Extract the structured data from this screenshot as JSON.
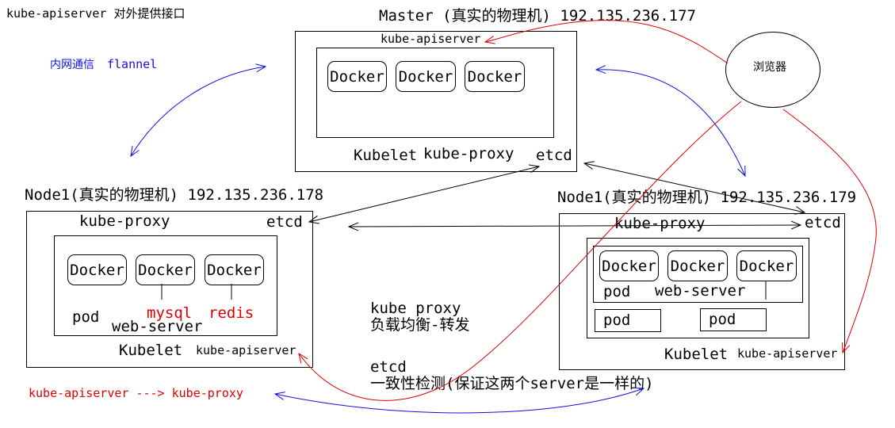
{
  "top_note": "kube-apiserver 对外提供接口",
  "network_note": {
    "label_cn": "内网通信",
    "label_en": "flannel"
  },
  "master": {
    "title": "Master (真实的物理机) 192.135.236.177",
    "apiserver": "kube-apiserver",
    "dockers": [
      "Docker",
      "Docker",
      "Docker"
    ],
    "kubelet": "Kubelet",
    "proxy": "kube-proxy",
    "etcd": "etcd"
  },
  "browser": {
    "label": "浏览器"
  },
  "node1": {
    "title": "Node1(真实的物理机) 192.135.236.178",
    "proxy": "kube-proxy",
    "etcd": "etcd",
    "dockers": [
      "Docker",
      "Docker",
      "Docker"
    ],
    "pod": "pod",
    "mysql": "mysql",
    "redis": "redis",
    "web_server": "web-server",
    "kubelet": "Kubelet",
    "apiserver": "kube-apiserver"
  },
  "node2": {
    "title": "Node1(真实的物理机) 192.135.236.179",
    "proxy": "kube-proxy",
    "etcd": "etcd",
    "dockers": [
      "Docker",
      "Docker",
      "Docker"
    ],
    "pod": "pod",
    "web_server": "web-server",
    "pod_a": "pod",
    "pod_b": "pod",
    "kubelet": "Kubelet",
    "apiserver": "kube-apiserver"
  },
  "notes": {
    "proxy_title": "kube proxy",
    "proxy_desc": "负载均衡-转发",
    "etcd_title": "etcd",
    "etcd_desc": "一致性检测(保证这两个server是一样的)"
  },
  "flow_note": "kube-apiserver ---> kube-proxy",
  "colors": {
    "red": "#e00000",
    "blue": "#1010e0",
    "black": "#000000"
  }
}
